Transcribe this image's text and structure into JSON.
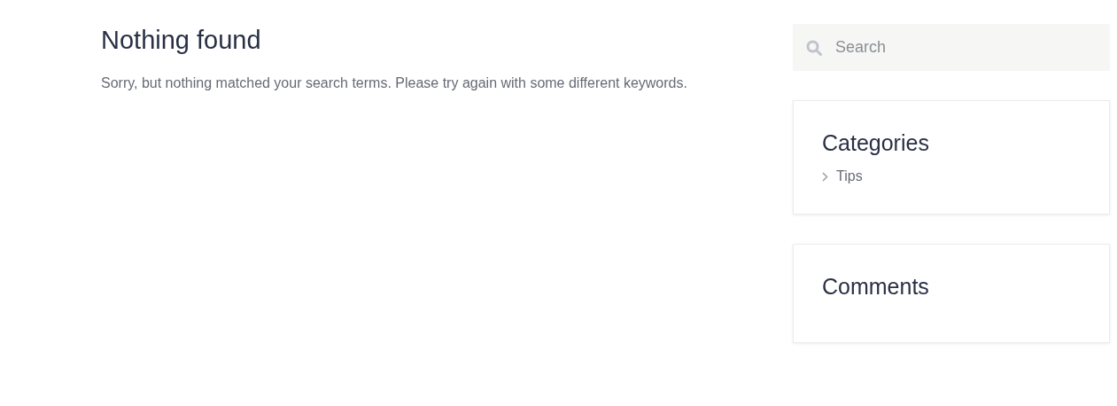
{
  "main": {
    "title": "Nothing found",
    "message": "Sorry, but nothing matched your search terms. Please try again with some different keywords."
  },
  "sidebar": {
    "search": {
      "placeholder": "Search"
    },
    "widgets": [
      {
        "title": "Categories",
        "items": [
          "Tips"
        ]
      },
      {
        "title": "Comments"
      }
    ]
  }
}
